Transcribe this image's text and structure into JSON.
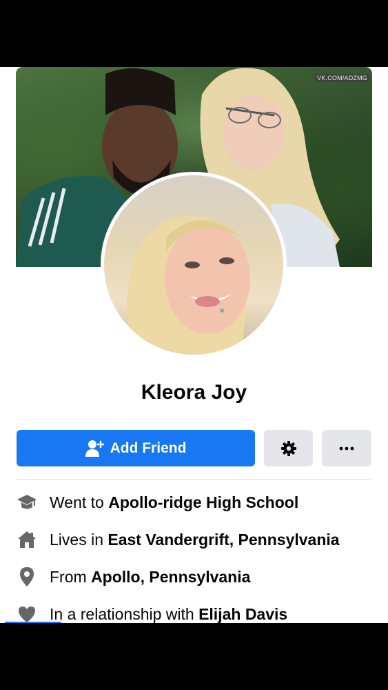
{
  "cover": {
    "watermark": "VK.COM/ADZMG"
  },
  "profile": {
    "name": "Kleora Joy"
  },
  "actions": {
    "add_friend_label": "Add Friend",
    "add_friend_icon": "add-person-icon",
    "settings_icon": "gear-icon",
    "more_label": "···",
    "more_icon": "more-dots-icon"
  },
  "details": [
    {
      "icon": "graduation-cap-icon",
      "prefix": "Went to",
      "value": "Apollo-ridge High School"
    },
    {
      "icon": "home-icon",
      "prefix": "Lives in",
      "value": "East Vandergrift, Pennsylvania"
    },
    {
      "icon": "location-pin-icon",
      "prefix": "From",
      "value": "Apollo, Pennsylvania"
    },
    {
      "icon": "heart-icon",
      "prefix": "In a relationship with",
      "value": "Elijah Davis"
    }
  ],
  "colors": {
    "primary": "#1877f2",
    "secondary_button": "#e4e6eb",
    "icon_gray": "#65676b",
    "text": "#050505"
  }
}
